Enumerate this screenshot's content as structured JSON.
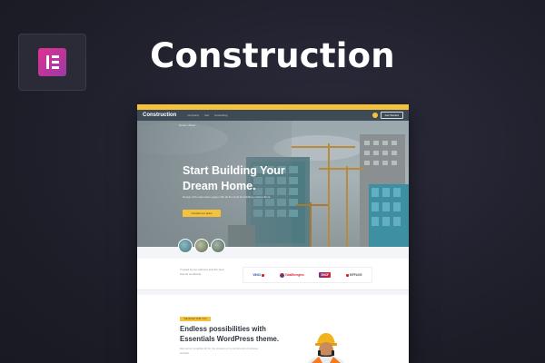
{
  "app": {
    "title": "Construction",
    "logo_icon": "elementor-logo"
  },
  "colors": {
    "accent": "#f5c33b",
    "nav_bg": "#3e4a56",
    "brand_pink": "#e0318f"
  },
  "site": {
    "brand": "Construction",
    "nav": {
      "links": [
        "Company",
        "Get",
        "Something"
      ],
      "cta": "Get Started"
    },
    "breadcrumbs": "Home / About",
    "hero": {
      "title": "Start Building Your Dream Home.",
      "text": "Design with responsive pages with all the tools for building creative firms.",
      "button": "Contact our team"
    },
    "partners": {
      "text": "Trusted by our partners and the best brands worldwide",
      "logos": [
        "VINCI",
        "TotalEnergies",
        "SNCF",
        "EIFFAGE"
      ]
    },
    "section": {
      "badge": "WE BUILD FOR YOU",
      "title": "Endless possibilities with Essentials WordPress theme.",
      "text": "Elementor template kit for the creation of a construction business website."
    }
  }
}
